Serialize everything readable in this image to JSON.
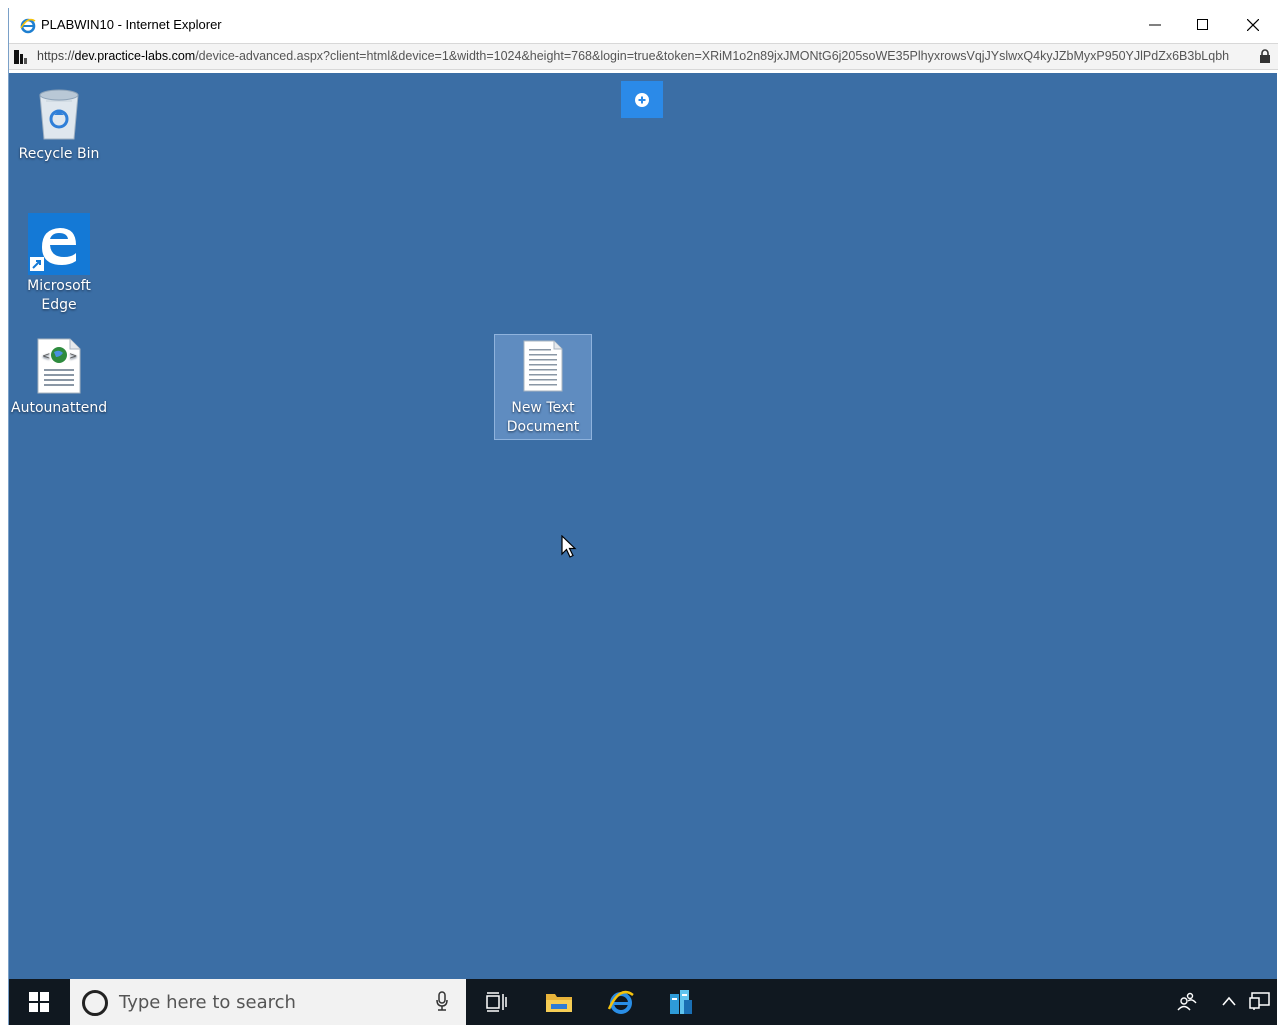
{
  "window": {
    "title": "PLABWIN10 - Internet Explorer",
    "controls": [
      "minimize",
      "maximize",
      "close"
    ]
  },
  "address_bar": {
    "protocol": "https://",
    "host": "dev.practice-labs.com",
    "path": "/device-advanced.aspx?client=html&device=1&width=1024&height=768&login=true&token=XRiM1o2n89jxJMONtG6j205soWE35PlhyxrowsVqjJYslwxQ4kyJZbMyxP950YJlPdZx6B3bLqbh"
  },
  "desktop": {
    "icons": [
      {
        "label": "Recycle Bin",
        "icon": "recycle-bin-icon"
      },
      {
        "label": "Microsoft Edge",
        "icon": "edge-icon"
      },
      {
        "label": "Autounattend",
        "icon": "xml-file-icon"
      },
      {
        "label": "New Text Document",
        "icon": "text-file-icon"
      }
    ]
  },
  "taskbar": {
    "search_placeholder": "Type here to search",
    "pinned": [
      "task-view-icon",
      "file-explorer-icon",
      "internet-explorer-icon",
      "server-manager-icon"
    ]
  },
  "colors": {
    "desktop": "#3b6ea5",
    "taskbar": "#101820",
    "toolbar_button": "#2b8ae8"
  }
}
